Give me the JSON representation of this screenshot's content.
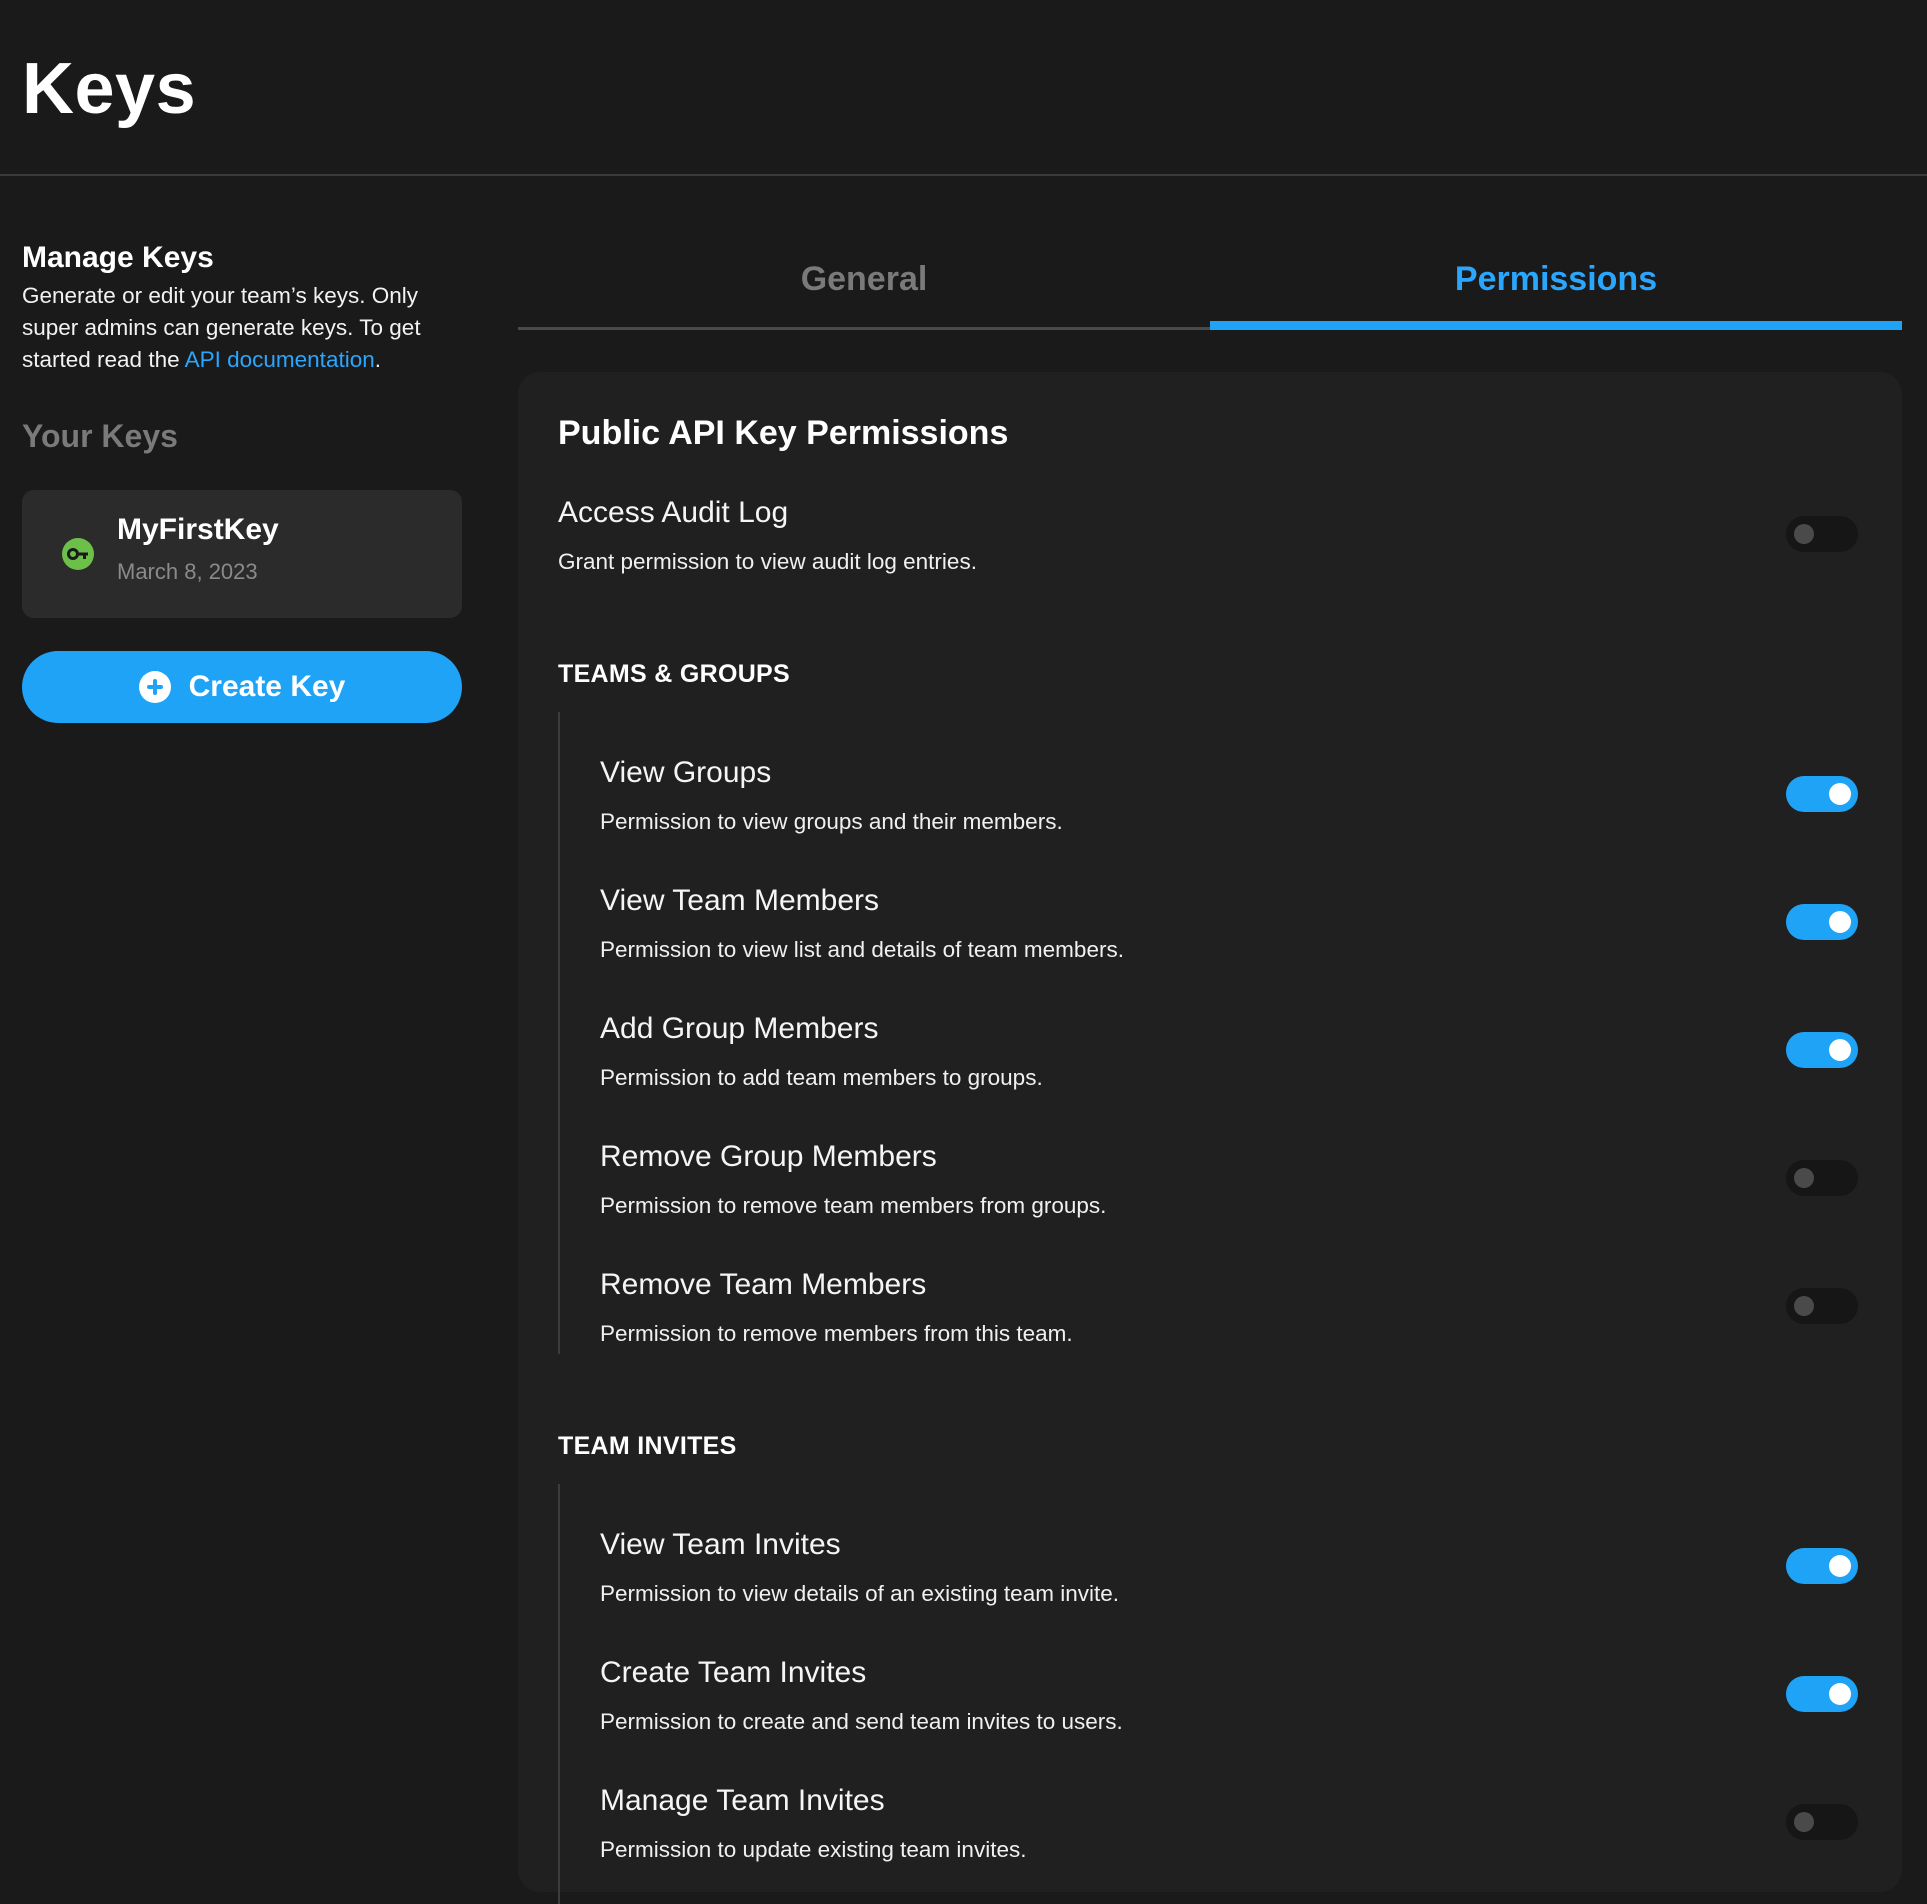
{
  "page": {
    "title": "Keys"
  },
  "sidebar": {
    "manage_title": "Manage Keys",
    "manage_desc_before": "Generate or edit your team’s keys. Only super admins can generate keys. To get started read the ",
    "manage_desc_link": "API documentation",
    "manage_desc_after": ".",
    "your_keys_title": "Your Keys",
    "keys": [
      {
        "name": "MyFirstKey",
        "date": "March 8, 2023",
        "icon": "key-icon",
        "icon_color": "#6cc04a"
      }
    ],
    "create_button_label": "Create Key"
  },
  "tabs": [
    {
      "label": "General",
      "active": false
    },
    {
      "label": "Permissions",
      "active": true
    }
  ],
  "permissions": {
    "panel_title": "Public API Key Permissions",
    "access_audit_log": {
      "title": "Access Audit Log",
      "desc": "Grant permission to view audit log entries.",
      "enabled": false
    },
    "sections": [
      {
        "heading": "TEAMS & GROUPS",
        "items": [
          {
            "title": "View Groups",
            "desc": "Permission to view groups and their members.",
            "enabled": true
          },
          {
            "title": "View Team Members",
            "desc": "Permission to view list and details of team members.",
            "enabled": true
          },
          {
            "title": "Add Group Members",
            "desc": "Permission to add team members to groups.",
            "enabled": true
          },
          {
            "title": "Remove Group Members",
            "desc": "Permission to remove team members from groups.",
            "enabled": false
          },
          {
            "title": "Remove Team Members",
            "desc": "Permission to remove members from this team.",
            "enabled": false
          }
        ]
      },
      {
        "heading": "TEAM INVITES",
        "items": [
          {
            "title": "View Team Invites",
            "desc": "Permission to view details of an existing team invite.",
            "enabled": true
          },
          {
            "title": "Create Team Invites",
            "desc": "Permission to create and send team invites to users.",
            "enabled": true
          },
          {
            "title": "Manage Team Invites",
            "desc": "Permission to update existing team invites.",
            "enabled": false
          }
        ]
      }
    ]
  },
  "colors": {
    "accent": "#1fa3f7",
    "background": "#1a1a1a",
    "panel": "#202020",
    "card": "#2b2b2b",
    "key_icon": "#6cc04a"
  }
}
